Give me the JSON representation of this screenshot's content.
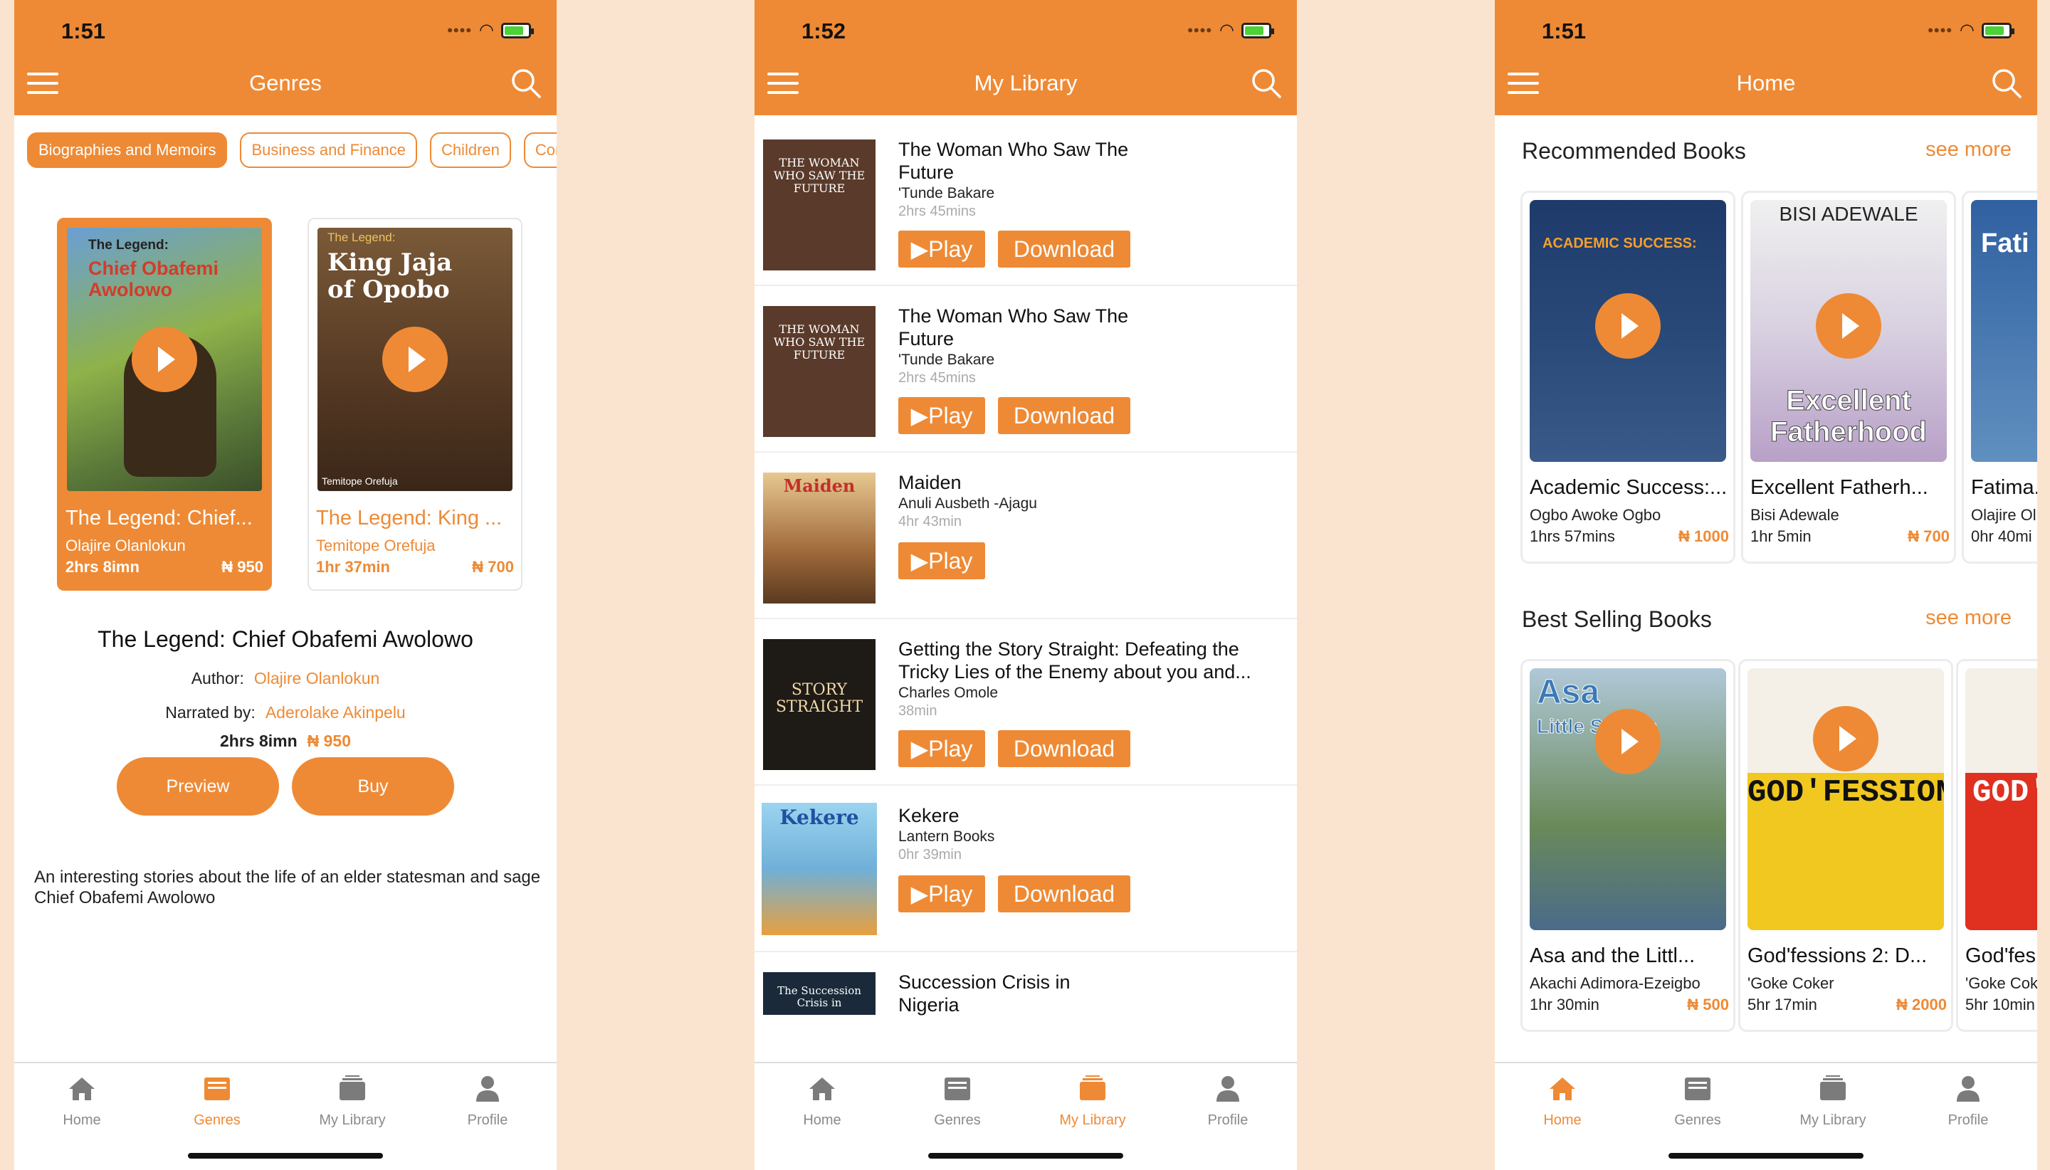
{
  "colors": {
    "accent": "#ee8a35",
    "background": "#fbe4cf"
  },
  "screens": [
    {
      "time": "1:51",
      "title": "Genres"
    },
    {
      "time": "1:52",
      "title": "My Library"
    },
    {
      "time": "1:51",
      "title": "Home"
    }
  ],
  "tabs": [
    "Home",
    "Genres",
    "My Library",
    "Profile"
  ],
  "genres": {
    "chips": [
      "Biographies and Memoirs",
      "Business and Finance",
      "Children",
      "Com"
    ],
    "cards": [
      {
        "cover_title": "The Legend:",
        "cover_subtitle": "Chief Obafemi Awolowo",
        "title": "The Legend: Chief...",
        "author": "Olajire Olanlokun",
        "duration": "2hrs 8imn",
        "price": "₦ 950"
      },
      {
        "cover_title": "The Legend:",
        "cover_subtitle": "King Jaja of Opobo",
        "cover_footer": "Temitope Orefuja",
        "title": "The Legend: King ...",
        "author": "Temitope Orefuja",
        "duration": "1hr 37min",
        "price": "₦ 700"
      }
    ],
    "detail": {
      "title": "The Legend: Chief Obafemi Awolowo",
      "author_label": "Author:",
      "author": "Olajire Olanlokun",
      "narrator_label": "Narrated by:",
      "narrator": "Aderolake Akinpelu",
      "duration": "2hrs 8imn",
      "price": "₦ 950",
      "preview": "Preview",
      "buy": "Buy",
      "description": "An interesting stories about the life of an elder statesman and sage Chief Obafemi Awolowo"
    }
  },
  "library": {
    "play": "▶Play",
    "download": "Download",
    "items": [
      {
        "title": "The Woman Who Saw The Future",
        "author": "'Tunde Bakare",
        "duration": "2hrs 45mins",
        "cover": "THE WOMAN WHO SAW THE FUTURE",
        "download": true
      },
      {
        "title": "The Woman Who Saw The Future",
        "author": "'Tunde Bakare",
        "duration": "2hrs 45mins",
        "cover": "THE WOMAN WHO SAW THE FUTURE",
        "download": true
      },
      {
        "title": "Maiden",
        "author": "Anuli Ausbeth -Ajagu",
        "duration": "4hr 43min",
        "cover": "Maiden",
        "download": false
      },
      {
        "title": "Getting the Story Straight: Defeating the Tricky Lies of the Enemy about you and...",
        "author": "Charles Omole",
        "duration": "38min",
        "cover": "STORY STRAIGHT",
        "download": true
      },
      {
        "title": "Kekere",
        "author": "Lantern Books",
        "duration": "0hr 39min",
        "cover": "Kekere",
        "download": true
      },
      {
        "title": "Succession Crisis in Nigeria",
        "author": "",
        "duration": "",
        "cover": "The Succession Crisis in",
        "download": false
      }
    ]
  },
  "home": {
    "recommended": {
      "heading": "Recommended Books",
      "more": "see more",
      "books": [
        {
          "title": "Academic Success:...",
          "author": "Ogbo Awoke Ogbo",
          "duration": "1hrs 57mins",
          "price": "₦ 1000",
          "cover": "ACADEMIC SUCCESS:"
        },
        {
          "title": "Excellent Fatherh...",
          "author": "Bisi Adewale",
          "duration": "1hr 5min",
          "price": "₦ 700",
          "cover": "BISI ADEWALE"
        },
        {
          "title": "Fatima...",
          "author": "Olajire Ol",
          "duration": "0hr 40mi",
          "price": "",
          "cover": "Fati"
        }
      ]
    },
    "bestselling": {
      "heading": "Best Selling Books",
      "more": "see more",
      "books": [
        {
          "title": "Asa and the Littl...",
          "author": "Akachi Adimora-Ezeigbo",
          "duration": "1hr 30min",
          "price": "₦ 500",
          "cover": "Asa"
        },
        {
          "title": "God'fessions 2: D...",
          "author": "'Goke Coker",
          "duration": "5hr 17min",
          "price": "₦ 2000",
          "cover": "GOD'FESSIONS"
        },
        {
          "title": "God'fes",
          "author": "'Goke Cok",
          "duration": "5hr 10min",
          "price": "",
          "cover": "GOD'F"
        }
      ]
    }
  }
}
